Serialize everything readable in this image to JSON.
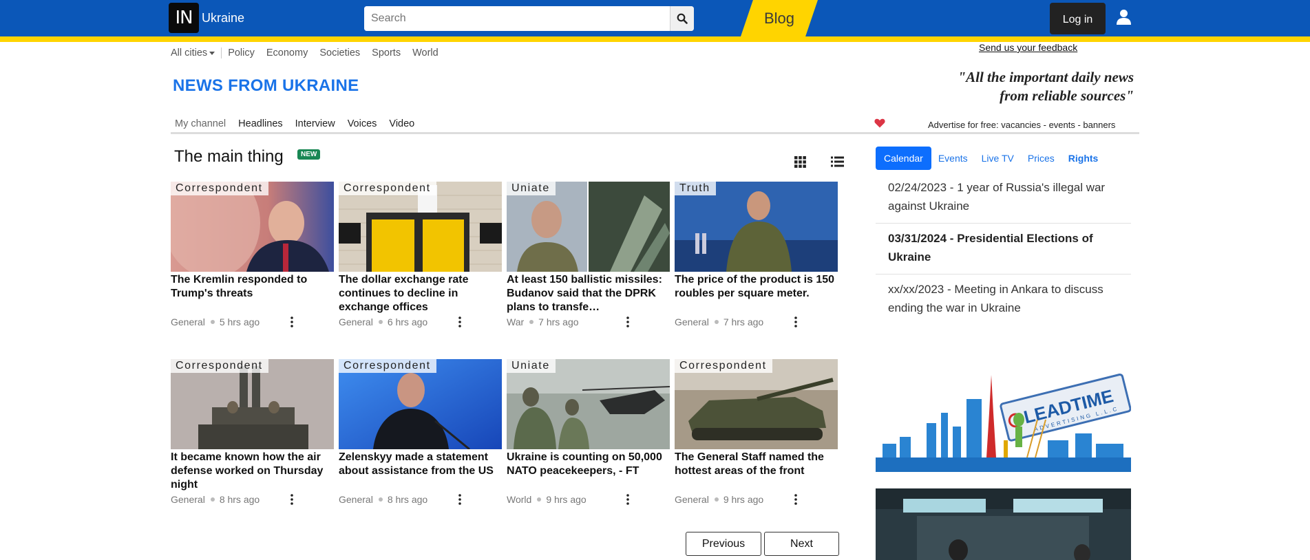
{
  "header": {
    "logo_text": "IN",
    "brand": "Ukraine",
    "search_placeholder": "Search",
    "blog_label": "Blog",
    "login_label": "Log in"
  },
  "feedback_link": "Send us your feedback",
  "cities_nav": {
    "all_label": "All cities",
    "items": [
      "Policy",
      "Economy",
      "Societies",
      "Sports",
      "World"
    ]
  },
  "page_title": "NEWS FROM UKRAINE",
  "quote": {
    "line1": "\"All the important daily news",
    "line2": "from reliable sources\""
  },
  "channel_nav": [
    "My channel",
    "Headlines",
    "Interview",
    "Voices",
    "Video"
  ],
  "advertise_text": "Advertise for free: vacancies - events - banners",
  "main": {
    "title": "The main thing",
    "badge": "NEW",
    "cards": [
      {
        "source": "Correspondent",
        "headline": "The Kremlin responded to Trump's threats",
        "category": "General",
        "time": "5 hrs ago"
      },
      {
        "source": "Correspondent",
        "headline": "The dollar exchange rate continues to decline in exchange offices",
        "category": "General",
        "time": "6 hrs ago"
      },
      {
        "source": "Uniate",
        "headline": "At least 150 ballistic missiles: Budanov said that the DPRK plans to transfe…",
        "category": "War",
        "time": "7 hrs ago"
      },
      {
        "source": "Truth",
        "headline": "The price of the product is 150 roubles per square meter.",
        "category": "General",
        "time": "7 hrs ago"
      },
      {
        "source": "Correspondent",
        "headline": "It became known how the air defense worked on Thursday night",
        "category": "General",
        "time": "8 hrs ago"
      },
      {
        "source": "Correspondent",
        "headline": "Zelenskyy made a statement about assistance from the US",
        "category": "General",
        "time": "8 hrs ago"
      },
      {
        "source": "Uniate",
        "headline": "Ukraine is counting on 50,000 NATO peacekeepers, - FT",
        "category": "World",
        "time": "9 hrs ago"
      },
      {
        "source": "Correspondent",
        "headline": "The General Staff named the hottest areas of the front",
        "category": "General",
        "time": "9 hrs ago"
      }
    ],
    "pager": {
      "previous": "Previous",
      "next": "Next"
    }
  },
  "sidebar": {
    "tabs": [
      "Calendar",
      "Events",
      "Live TV",
      "Prices",
      "Rights"
    ],
    "events": [
      "02/24/2023 - 1 year of Russia's illegal war against Ukraine",
      "03/31/2024 - Presidential Elections of Ukraine",
      "xx/xx/2023 - Meeting in Ankara to discuss ending the war in Ukraine"
    ],
    "ad_brand": "LEADTIME",
    "ad_sub": "ADVERTISING L.L.C"
  },
  "colors": {
    "header_blue": "#0b57b8",
    "header_yellow": "#ffd400",
    "title_blue": "#1a73e8",
    "badge_green": "#198754"
  }
}
